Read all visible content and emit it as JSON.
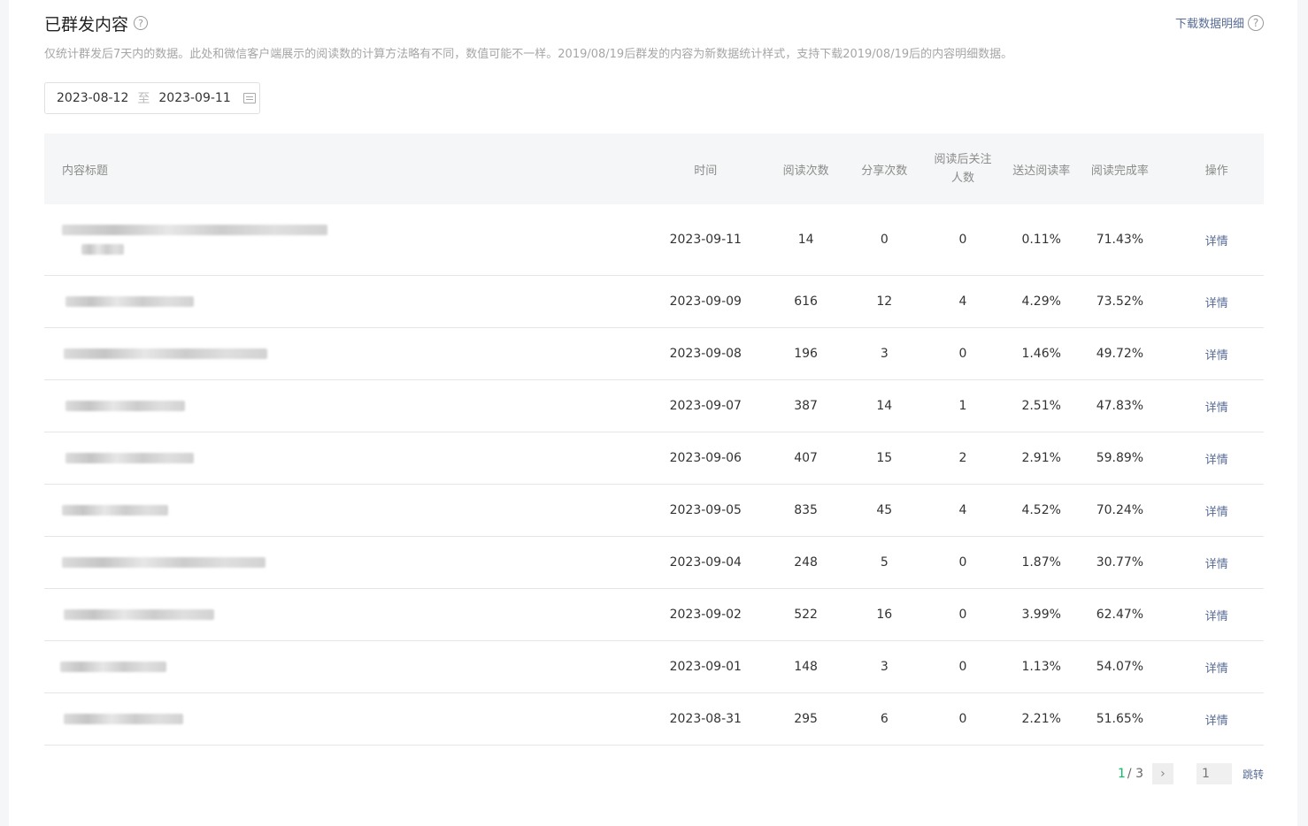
{
  "header": {
    "title": "已群发内容",
    "help_icon": "?",
    "download_label": "下载数据明细",
    "note": "仅统计群发后7天内的数据。此处和微信客户端展示的阅读数的计算方法略有不同，数值可能不一样。2019/08/19后群发的内容为新数据统计样式，支持下载2019/08/19后的内容明细数据。"
  },
  "date_range": {
    "start": "2023-08-12",
    "separator": "至",
    "end": "2023-09-11",
    "icon": "calendar-icon"
  },
  "table": {
    "headers": {
      "title": "内容标题",
      "time": "时间",
      "reads": "阅读次数",
      "shares": "分享次数",
      "follows_line1": "阅读后关注",
      "follows_line2": "人数",
      "deliver_rate": "送达阅读率",
      "complete_rate": "阅读完成率",
      "action": "操作"
    },
    "rows": [
      {
        "time": "2023-09-11",
        "reads": "14",
        "shares": "0",
        "follows": "0",
        "deliver_rate": "0.11%",
        "complete_rate": "71.43%",
        "action": "详情"
      },
      {
        "time": "2023-09-09",
        "reads": "616",
        "shares": "12",
        "follows": "4",
        "deliver_rate": "4.29%",
        "complete_rate": "73.52%",
        "action": "详情"
      },
      {
        "time": "2023-09-08",
        "reads": "196",
        "shares": "3",
        "follows": "0",
        "deliver_rate": "1.46%",
        "complete_rate": "49.72%",
        "action": "详情"
      },
      {
        "time": "2023-09-07",
        "reads": "387",
        "shares": "14",
        "follows": "1",
        "deliver_rate": "2.51%",
        "complete_rate": "47.83%",
        "action": "详情"
      },
      {
        "time": "2023-09-06",
        "reads": "407",
        "shares": "15",
        "follows": "2",
        "deliver_rate": "2.91%",
        "complete_rate": "59.89%",
        "action": "详情"
      },
      {
        "time": "2023-09-05",
        "reads": "835",
        "shares": "45",
        "follows": "4",
        "deliver_rate": "4.52%",
        "complete_rate": "70.24%",
        "action": "详情"
      },
      {
        "time": "2023-09-04",
        "reads": "248",
        "shares": "5",
        "follows": "0",
        "deliver_rate": "1.87%",
        "complete_rate": "30.77%",
        "action": "详情"
      },
      {
        "time": "2023-09-02",
        "reads": "522",
        "shares": "16",
        "follows": "0",
        "deliver_rate": "3.99%",
        "complete_rate": "62.47%",
        "action": "详情"
      },
      {
        "time": "2023-09-01",
        "reads": "148",
        "shares": "3",
        "follows": "0",
        "deliver_rate": "1.13%",
        "complete_rate": "54.07%",
        "action": "详情"
      },
      {
        "time": "2023-08-31",
        "reads": "295",
        "shares": "6",
        "follows": "0",
        "deliver_rate": "2.21%",
        "complete_rate": "51.65%",
        "action": "详情"
      }
    ]
  },
  "pagination": {
    "current": "1",
    "total": "/ 3",
    "next_icon": "chevron-right-icon",
    "input_placeholder": "1",
    "jump_label": "跳转"
  },
  "colors": {
    "link": "#576b95",
    "accent": "#07c160"
  }
}
